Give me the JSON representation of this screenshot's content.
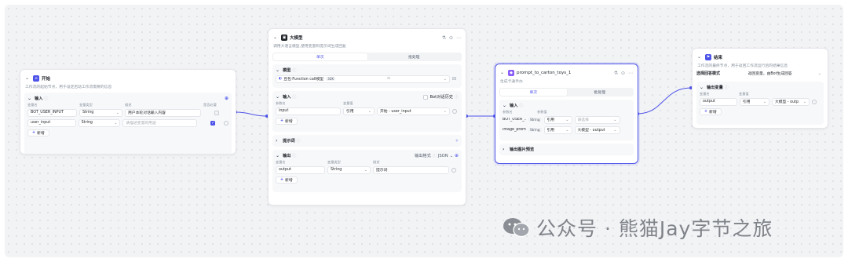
{
  "start": {
    "title": "开始",
    "desc": "工作流的起始节点，用于设定启动工作流需要的信息",
    "section": "输入",
    "col_name": "变量名",
    "col_type": "变量类型",
    "col_desc": "描述",
    "col_required": "是否必要",
    "rows": [
      {
        "name": "BOT_USER_INPUT",
        "type": "String",
        "desc": "用户本轮对话输入内容"
      },
      {
        "name": "user_input",
        "type": "String",
        "desc": "请描述变量的用途"
      }
    ],
    "add": "新增"
  },
  "llm": {
    "title": "大模型",
    "desc": "调用大语言模型,使用变量和提示词生成回复",
    "tab_single": "单次",
    "tab_batch": "批处理",
    "model_section": "模型",
    "model_name": "豆包·Function call模型",
    "model_ctx": "32K",
    "input_section": "输入",
    "bot_history": "Bot对话历史",
    "col_param": "参数名",
    "col_value": "变量值",
    "input_param": "input",
    "input_ref": "引用",
    "input_value": "开始 - user_input",
    "add": "新增",
    "prompt_section": "提示词",
    "output_section": "输出",
    "output_format_label": "输出格式",
    "output_format": "JSON",
    "col_varname": "变量名",
    "col_vartype": "变量类型",
    "col_desc": "描述",
    "output_name": "output",
    "output_type": "String",
    "output_desc": "提示词"
  },
  "plugin": {
    "title": "prompt_to_carton_toys_1",
    "desc": "生成卡通手办",
    "tab_single": "单次",
    "tab_batch": "批处理",
    "input_section": "输入",
    "col_param": "参数名",
    "col_value": "参数值",
    "rows": [
      {
        "name": "BOT_USER_...",
        "type": "String",
        "ref": "引用",
        "value": "请选择",
        "placeholder": true
      },
      {
        "name": "image_prompt*",
        "type": "String",
        "ref": "引用",
        "value": "大模型 - output",
        "placeholder": false
      }
    ],
    "output_preview": "输出图片预览"
  },
  "end": {
    "title": "结束",
    "desc": "工作流的最终节点，用于返回工作流运行后的结果信息",
    "mode_label": "选择回答模式",
    "mode_value": "返回变量，由Bot生成回答",
    "output_section": "输出变量",
    "col_varname": "变量名",
    "col_value": "变量值",
    "output_name": "output",
    "output_ref": "引用",
    "output_value": "大模型 - outp",
    "add": "新增"
  },
  "watermark": "公众号 · 熊猫Jay字节之旅",
  "colors": {
    "accent": "#4d53e8",
    "start_icon": "#4d53e8",
    "llm_icon": "#1f2329",
    "plugin_icon": "#8b5cf6",
    "end_icon": "#4d53e8"
  }
}
